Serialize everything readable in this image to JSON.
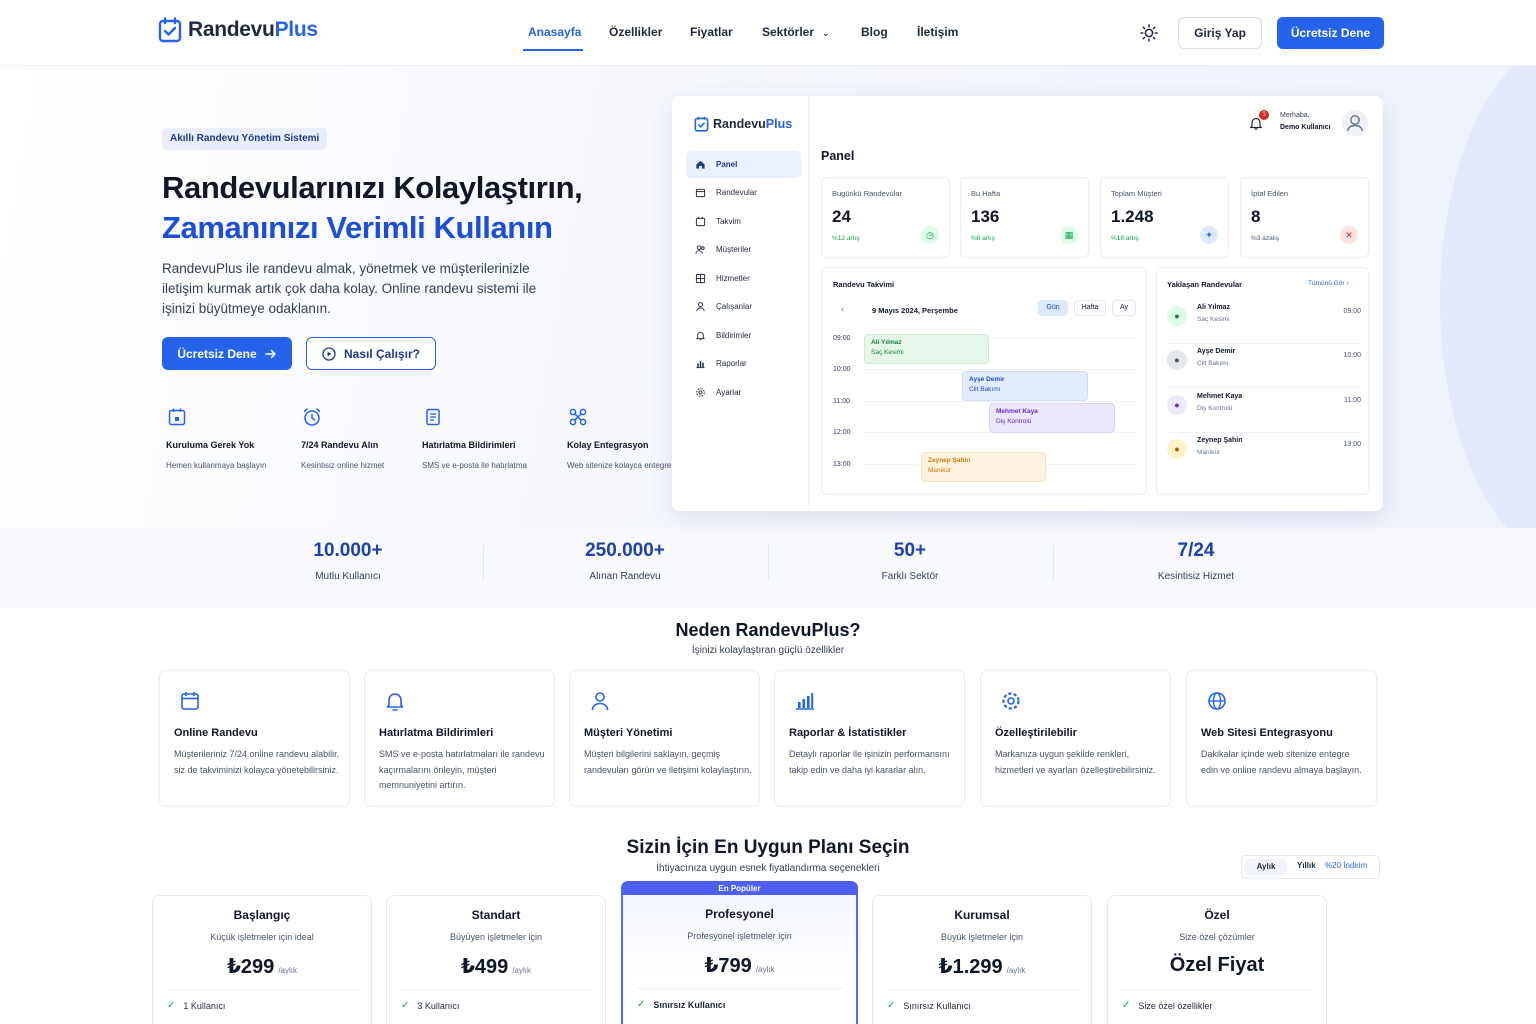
{
  "brand": {
    "name_a": "Randevu",
    "name_b": "Plus"
  },
  "nav": {
    "items": [
      "Anasayfa",
      "Özellikler",
      "Fiyatlar",
      "Sektörler",
      "Blog",
      "İletişim"
    ],
    "login": "Giriş Yap",
    "cta": "Ücretsiz Dene"
  },
  "hero": {
    "badge": "Akıllı Randevu Yönetim Sistemi",
    "title_1": "Randevularınızı Kolaylaştırın,",
    "title_2": "Zamanınızı Verimli Kullanın",
    "lead": "RandevuPlus ile randevu almak, yönetmek ve müşterilerinizle iletişim kurmak artık çok daha kolay. Online randevu sistemi ile işinizi büyütmeye odaklanın.",
    "cta_primary": "Ücretsiz Dene",
    "cta_secondary": "Nasıl Çalışır?",
    "features": [
      {
        "title": "Kuruluma Gerek Yok",
        "desc": "Hemen kullanmaya başlayın"
      },
      {
        "title": "7/24 Randevu Alın",
        "desc": "Kesintisiz online hizmet"
      },
      {
        "title": "Hatırlatma Bildirimleri",
        "desc": "SMS ve e-posta ile hatırlatma"
      },
      {
        "title": "Kolay Entegrasyon",
        "desc": "Web sitenize kolayca entegre edin"
      }
    ]
  },
  "dashboard": {
    "menu": [
      "Panel",
      "Randevular",
      "Takvim",
      "Müşteriler",
      "Hizmetler",
      "Çalışanlar",
      "Bildirimler",
      "Raporlar",
      "Ayarlar"
    ],
    "page_title": "Panel",
    "greeting": "Merhaba,",
    "user": "Demo Kullanıcı",
    "notif_count": "3",
    "kpis": [
      {
        "label": "Bugünkü Randevular",
        "value": "24",
        "change": "%12 artış",
        "color": "#16a34a"
      },
      {
        "label": "Bu Hafta",
        "value": "136",
        "change": "%8 artış",
        "color": "#16a34a"
      },
      {
        "label": "Toplam Müşteri",
        "value": "1.248",
        "change": "%18 artış",
        "color": "#16a34a"
      },
      {
        "label": "İptal Edilen",
        "value": "8",
        "change": "%3 azalış",
        "color": "#475569"
      }
    ],
    "calendar": {
      "title": "Randevu Takvimi",
      "date": "9 Mayıs 2024, Perşembe",
      "views": [
        "Gün",
        "Hafta",
        "Ay"
      ],
      "times": [
        "09:00",
        "10:00",
        "11:00",
        "12:00",
        "13:00"
      ],
      "events": [
        {
          "name": "Ali Yılmaz",
          "service": "Saç Kesimi"
        },
        {
          "name": "Ayşe Demir",
          "service": "Cilt Bakımı"
        },
        {
          "name": "Mehmet Kaya",
          "service": "Diş Kontrolü"
        },
        {
          "name": "Zeynep Şahin",
          "service": "Manikür"
        }
      ]
    },
    "upcoming": {
      "title": "Yaklaşan Randevular",
      "see_all": "Tümünü Gör",
      "items": [
        {
          "name": "Ali Yılmaz",
          "service": "Saç Kesimi",
          "time": "09:00"
        },
        {
          "name": "Ayşe Demir",
          "service": "Cilt Bakımı",
          "time": "10:00"
        },
        {
          "name": "Mehmet Kaya",
          "service": "Diş Kontrolü",
          "time": "11:00"
        },
        {
          "name": "Zeynep Şahin",
          "service": "Manikür",
          "time": "13:00"
        }
      ]
    }
  },
  "stats": [
    {
      "value": "10.000+",
      "label": "Mutlu Kullanıcı"
    },
    {
      "value": "250.000+",
      "label": "Alınan Randevu"
    },
    {
      "value": "50+",
      "label": "Farklı Sektör"
    },
    {
      "value": "7/24",
      "label": "Kesintisiz Hizmet"
    }
  ],
  "why": {
    "title": "Neden RandevuPlus?",
    "subtitle": "İşinizi kolaylaştıran güçlü özellikler",
    "cards": [
      {
        "title": "Online Randevu",
        "desc": "Müşterileriniz 7/24 online randevu alabilir, siz de takviminizi kolayca yönetebilirsiniz."
      },
      {
        "title": "Hatırlatma Bildirimleri",
        "desc": "SMS ve e-posta hatırlatmaları ile randevu kaçırmalarını önleyin, müşteri memnuniyetini artırın."
      },
      {
        "title": "Müşteri Yönetimi",
        "desc": "Müşteri bilgilerini saklayın, geçmiş randevuları görün ve iletişimi kolaylaştırın."
      },
      {
        "title": "Raporlar & İstatistikler",
        "desc": "Detaylı raporlar ile işinizin performansını takip edin ve daha iyi kararlar alın."
      },
      {
        "title": "Özelleştirilebilir",
        "desc": "Markanıza uygun şekilde renkleri, hizmetleri ve ayarları özelleştirebilirsiniz."
      },
      {
        "title": "Web Sitesi Entegrasyonu",
        "desc": "Dakikalar içinde web sitenize entegre edin ve online randevu almaya başlayın."
      }
    ]
  },
  "pricing": {
    "title": "Sizin İçin En Uygun Planı Seçin",
    "subtitle": "İhtiyacınıza uygun esnek fiyatlandırma seçenekleri",
    "toggle_monthly": "Aylık",
    "toggle_yearly": "Yıllık",
    "toggle_discount": "%20 İndirim",
    "popular_label": "En Popüler",
    "plans": [
      {
        "name": "Başlangıç",
        "desc": "Küçük işletmeler için ideal",
        "price": "₺299",
        "period": "/aylık",
        "feature": "1 Kullanıcı"
      },
      {
        "name": "Standart",
        "desc": "Büyüyen işletmeler için",
        "price": "₺499",
        "period": "/aylık",
        "feature": "3 Kullanıcı"
      },
      {
        "name": "Profesyonel",
        "desc": "Profesyonel işletmeler için",
        "price": "₺799",
        "period": "/aylık",
        "feature": "Sınırsız Kullanıcı"
      },
      {
        "name": "Kurumsal",
        "desc": "Büyük işletmeler için",
        "price": "₺1.299",
        "period": "/aylık",
        "feature": "Sınırsız Kullanıcı"
      },
      {
        "name": "Özel",
        "desc": "Size özel çözümler",
        "price": "Özel Fiyat",
        "period": "",
        "feature": "Size özel özellikler"
      }
    ]
  },
  "colors": {
    "primary": "#2563eb",
    "heading_accent": "#1d4ed8",
    "success": "#16a34a",
    "danger": "#dc2626"
  }
}
